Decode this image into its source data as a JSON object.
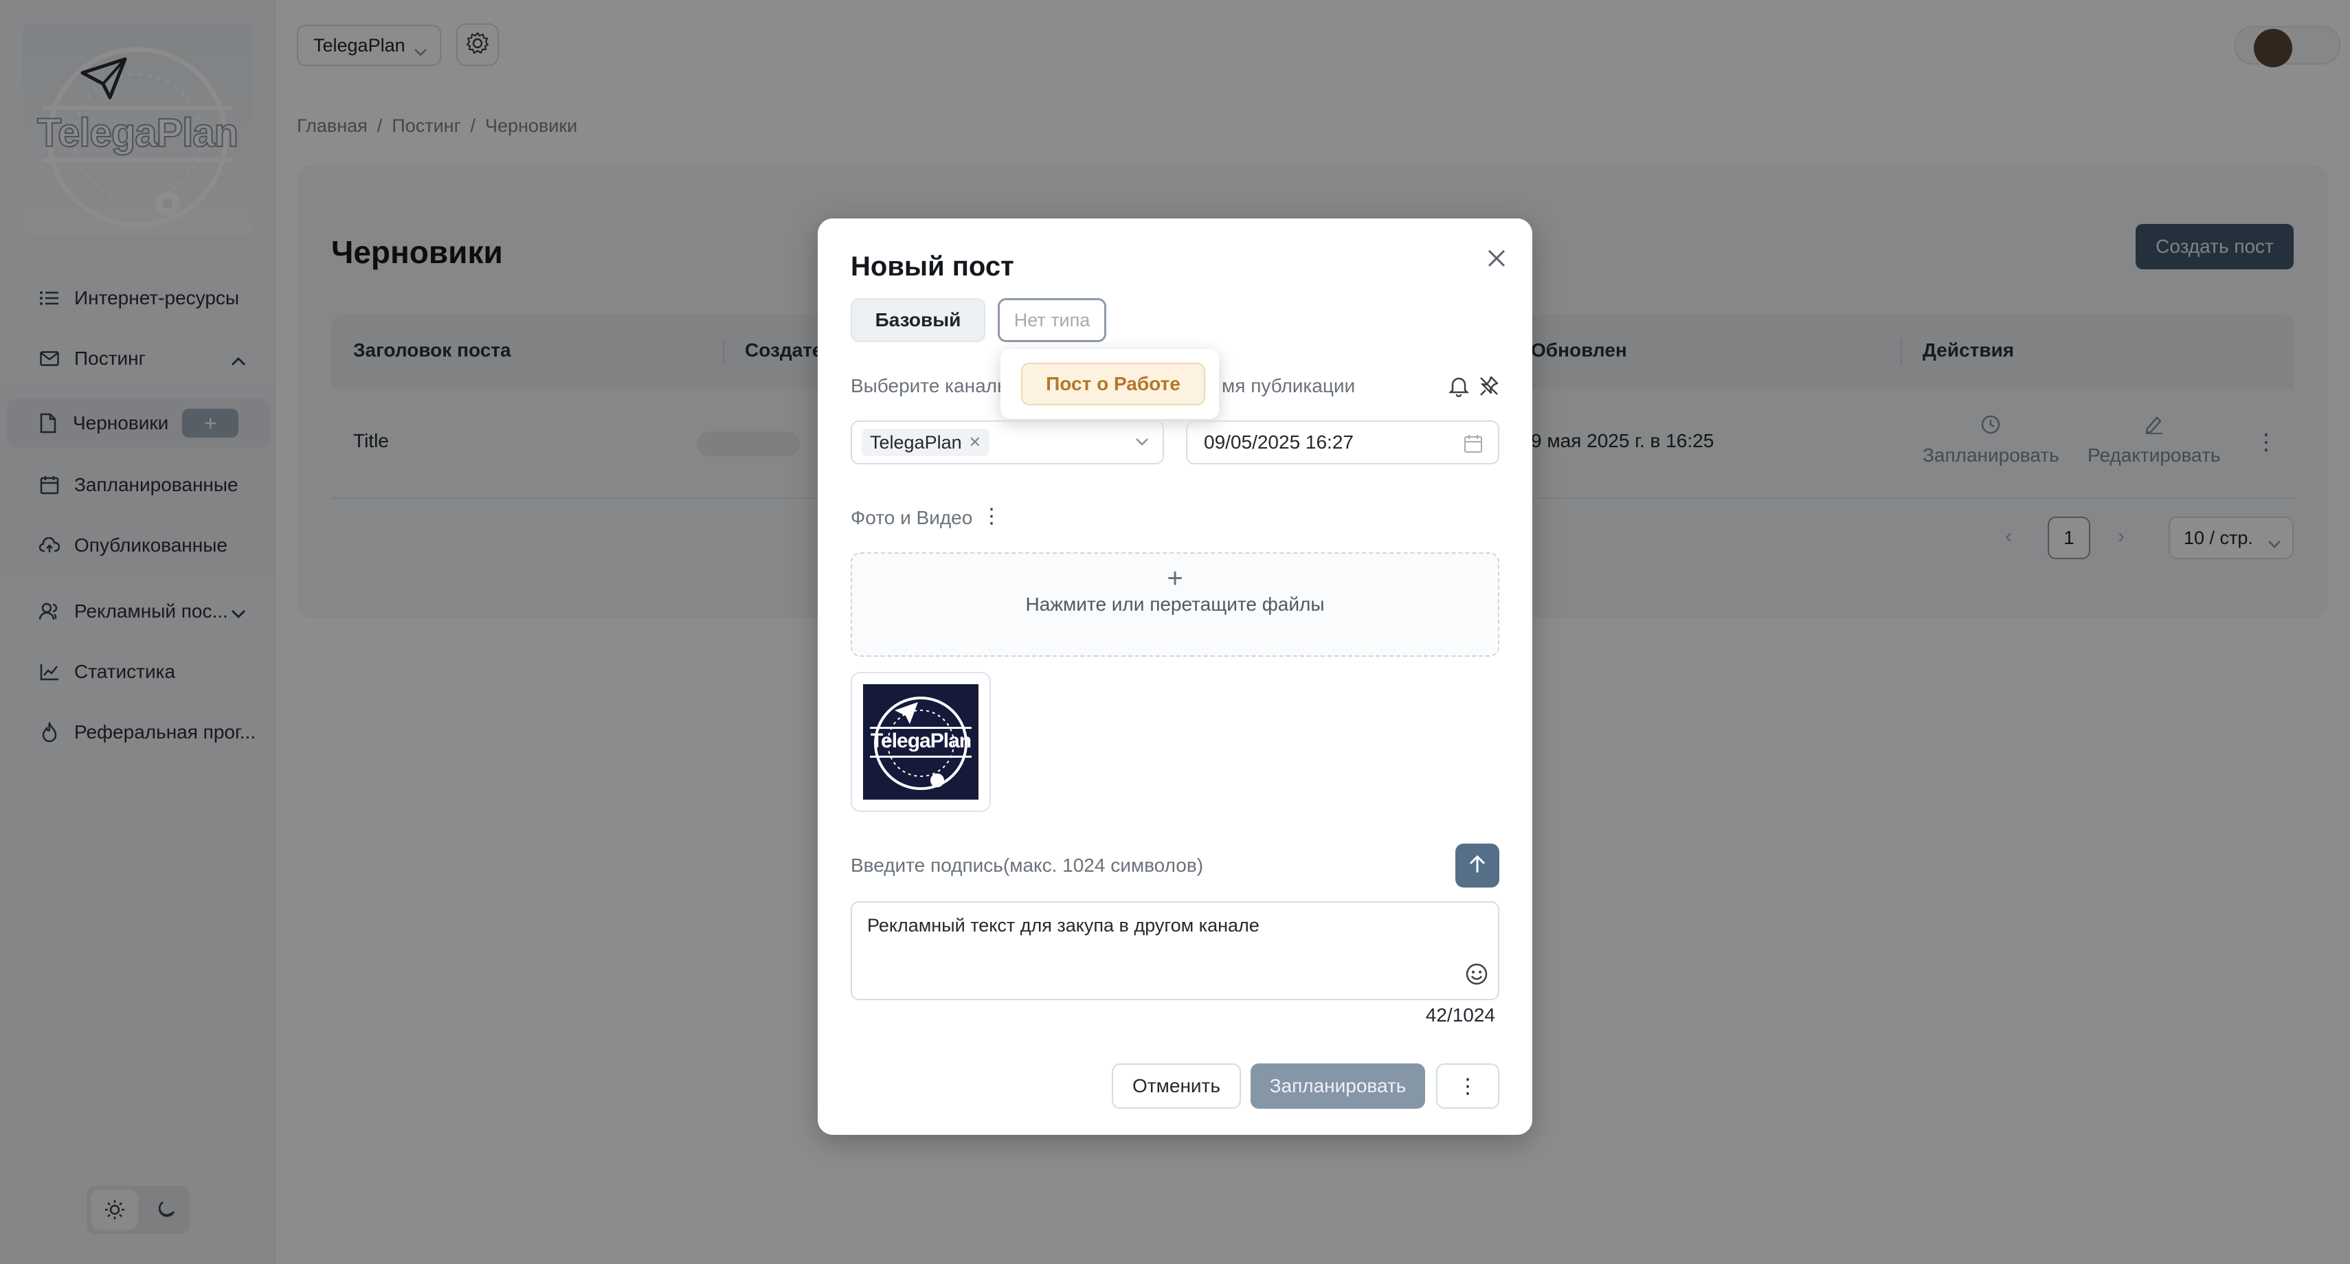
{
  "brand": {
    "logo_text": "TelegaPlan"
  },
  "sidebar": {
    "items": [
      {
        "label": "Интернет-ресурсы",
        "icon": "list-icon"
      },
      {
        "label": "Постинг",
        "icon": "mail-icon"
      },
      {
        "label": "Черновики",
        "icon": "document-icon"
      },
      {
        "label": "Запланированные",
        "icon": "calendar-icon"
      },
      {
        "label": "Опубликованные",
        "icon": "cloud-upload-icon"
      },
      {
        "label": "Рекламный пос...",
        "icon": "user-group-icon"
      },
      {
        "label": "Статистика",
        "icon": "chart-line-icon"
      },
      {
        "label": "Реферальная прог...",
        "icon": "fire-icon"
      }
    ],
    "add_label": "+"
  },
  "header": {
    "project": "TelegaPlan"
  },
  "breadcrumb": [
    "Главная",
    "Постинг",
    "Черновики"
  ],
  "page": {
    "title": "Черновики",
    "create_button": "Создать пост",
    "columns": [
      "Заголовок поста",
      "Создате",
      "Обновлен",
      "Действия"
    ],
    "rows": [
      {
        "title": "Title",
        "updated": "9 мая 2025 г. в 16:25"
      }
    ],
    "actions": {
      "schedule": "Запланировать",
      "edit": "Редактировать"
    },
    "pagination": {
      "current": "1",
      "page_size": "10 / стр."
    }
  },
  "modal": {
    "title": "Новый пост",
    "tab_basic": "Базовый",
    "tab_type_placeholder": "Нет типа",
    "type_option": "Пост о Работе",
    "channel_label": "Выберите каналь",
    "time_label": "мя публикации",
    "channel_tag": "TelegaPlan",
    "datetime": "09/05/2025 16:27",
    "media_label": "Фото и Видео",
    "upload_plus": "+",
    "upload_hint": "Нажмите или перетащите файлы",
    "thumb_text": "TelegaPlan",
    "caption_label": "Введите подпись(макс. 1024 символов)",
    "caption_text": "Рекламный текст для закупа в другом канале",
    "counter": "42/1024",
    "cancel": "Отменить",
    "schedule": "Запланировать",
    "more": "⋮"
  }
}
